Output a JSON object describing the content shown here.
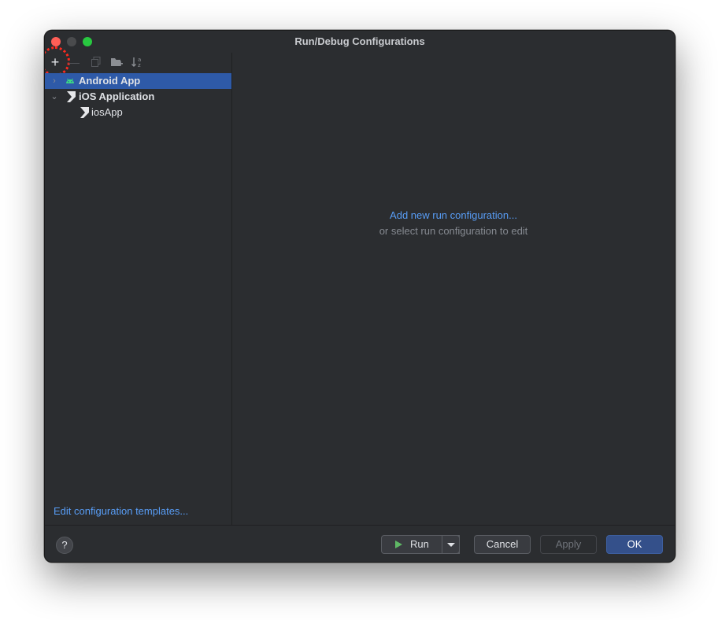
{
  "window": {
    "title": "Run/Debug Configurations"
  },
  "toolbar": {
    "add_icon": "plus-icon",
    "remove_icon": "minus-icon",
    "copy_icon": "copy-icon",
    "folder_icon": "new-folder-icon",
    "sort_icon": "sort-alphabetically-icon"
  },
  "tree": {
    "items": [
      {
        "label": "Android App",
        "icon": "android-icon",
        "expanded": false,
        "selected": true
      },
      {
        "label": "iOS Application",
        "icon": "kotlin-ios-icon",
        "expanded": true,
        "selected": false
      },
      {
        "label": "iosApp",
        "icon": "kotlin-ios-icon",
        "selected": false
      }
    ]
  },
  "left": {
    "edit_templates": "Edit configuration templates..."
  },
  "main": {
    "add_link": "Add new run configuration...",
    "hint": "or select run configuration to edit"
  },
  "footer": {
    "help": "?",
    "run": "Run",
    "cancel": "Cancel",
    "apply": "Apply",
    "ok": "OK"
  },
  "colors": {
    "background": "#2b2d30",
    "selection": "#2e5aa8",
    "link": "#589df6",
    "ok_button": "#34508a",
    "run_icon": "#5fb865",
    "annotation": "#ff2a1f"
  }
}
